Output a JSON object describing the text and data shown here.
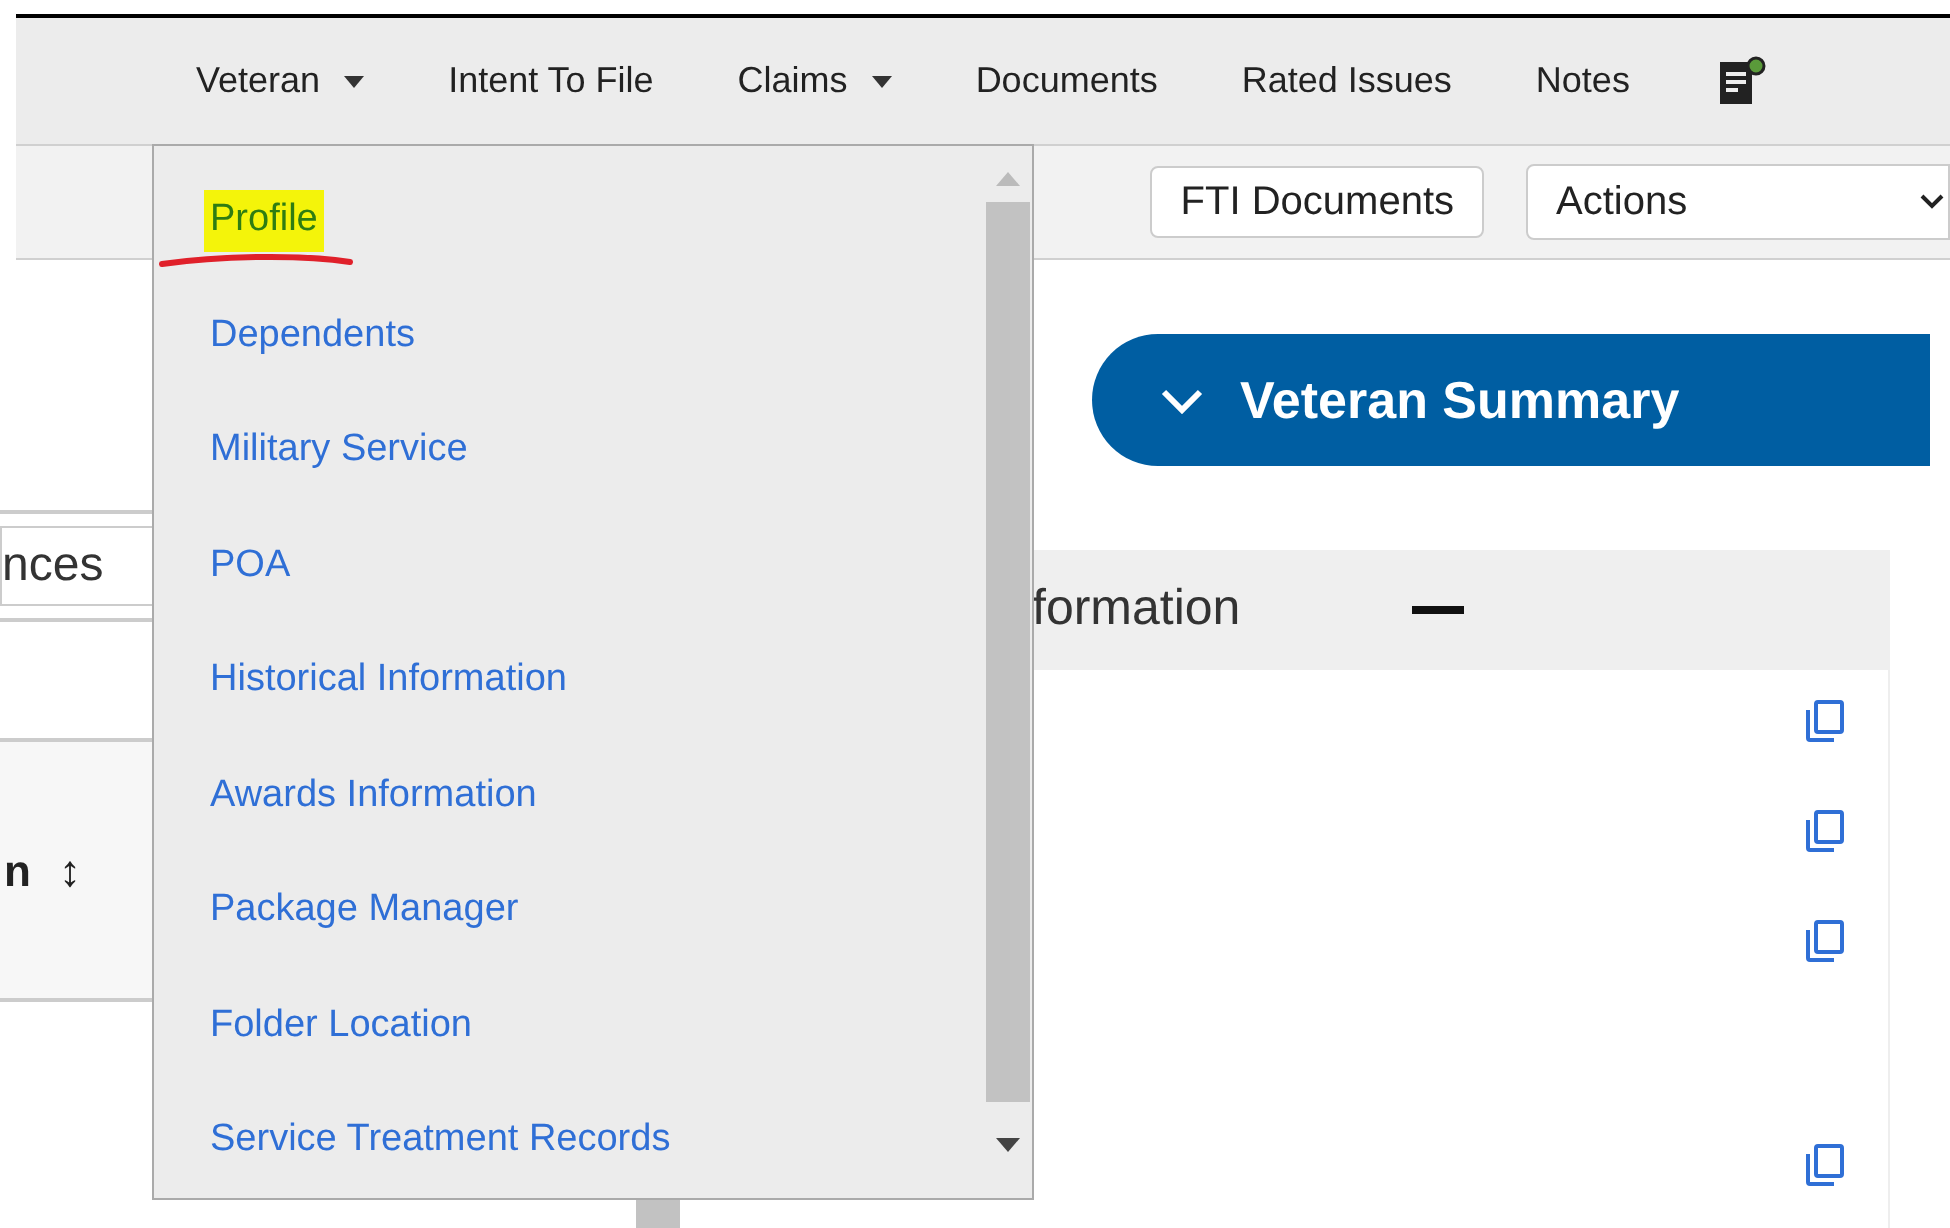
{
  "nav": {
    "items": [
      {
        "label": "Veteran",
        "has_menu": true
      },
      {
        "label": "Intent To File",
        "has_menu": false
      },
      {
        "label": "Claims",
        "has_menu": true
      },
      {
        "label": "Documents",
        "has_menu": false
      },
      {
        "label": "Rated Issues",
        "has_menu": false
      },
      {
        "label": "Notes",
        "has_menu": false
      }
    ]
  },
  "toolbar": {
    "button": "FTI Documents",
    "select": {
      "value": "Actions"
    }
  },
  "left_panel": {
    "field_value": "nces",
    "column_header": "n",
    "sort_glyph": "↕"
  },
  "summary": {
    "title": "Veteran Summary",
    "expanded": true
  },
  "info_panel": {
    "title": "formation",
    "expanded": true
  },
  "menu": {
    "items": [
      {
        "label": "Profile",
        "highlighted": true
      },
      {
        "label": "Dependents",
        "highlighted": false
      },
      {
        "label": "Military Service",
        "highlighted": false
      },
      {
        "label": "POA",
        "highlighted": false
      },
      {
        "label": "Historical Information",
        "highlighted": false
      },
      {
        "label": "Awards Information",
        "highlighted": false
      },
      {
        "label": "Package Manager",
        "highlighted": false
      },
      {
        "label": "Folder Location",
        "highlighted": false
      },
      {
        "label": "Service Treatment Records",
        "highlighted": false
      }
    ]
  }
}
